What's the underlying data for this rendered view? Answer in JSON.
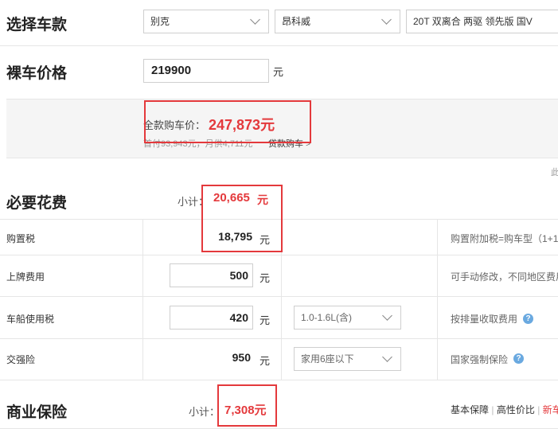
{
  "select_car": {
    "title": "选择车款",
    "brand": "别克",
    "series": "昂科威",
    "model": "20T 双离合 两驱 领先版 国V"
  },
  "bare_price": {
    "title": "裸车价格",
    "value": "219900",
    "unit": "元"
  },
  "total": {
    "label": "全款购车价：",
    "value": "247,873元",
    "sub_text": "首付93,943元，月供4,711元",
    "loan_link": "贷款购车",
    "loan_arrow": ">"
  },
  "edge_text": "此",
  "required": {
    "title": "必要花费",
    "subtotal_label": "小计：",
    "subtotal_value": "20,665",
    "subtotal_unit": "元",
    "rows": [
      {
        "label": "购置税",
        "value": "18,795",
        "unit": "元",
        "note": "购置附加税=购车型（1+1"
      },
      {
        "label": "上牌费用",
        "value": "500",
        "unit": "元",
        "note": "可手动修改，不同地区费用"
      },
      {
        "label": "车船使用税",
        "value": "420",
        "unit": "元",
        "option": "1.0-1.6L(含)",
        "note": "按排量收取费用"
      },
      {
        "label": "交强险",
        "value": "950",
        "unit": "元",
        "option": "家用6座以下",
        "note": "国家强制保险"
      }
    ]
  },
  "commercial": {
    "title": "商业保险",
    "subtotal_label": "小计：",
    "subtotal_value": "7,308元",
    "plans": [
      "基本保障",
      "高性价比",
      "新车"
    ],
    "separator": "|"
  },
  "colors": {
    "accent_red": "#e4393c",
    "help_blue": "#6aa9e0",
    "line": "#e6e6e6"
  }
}
